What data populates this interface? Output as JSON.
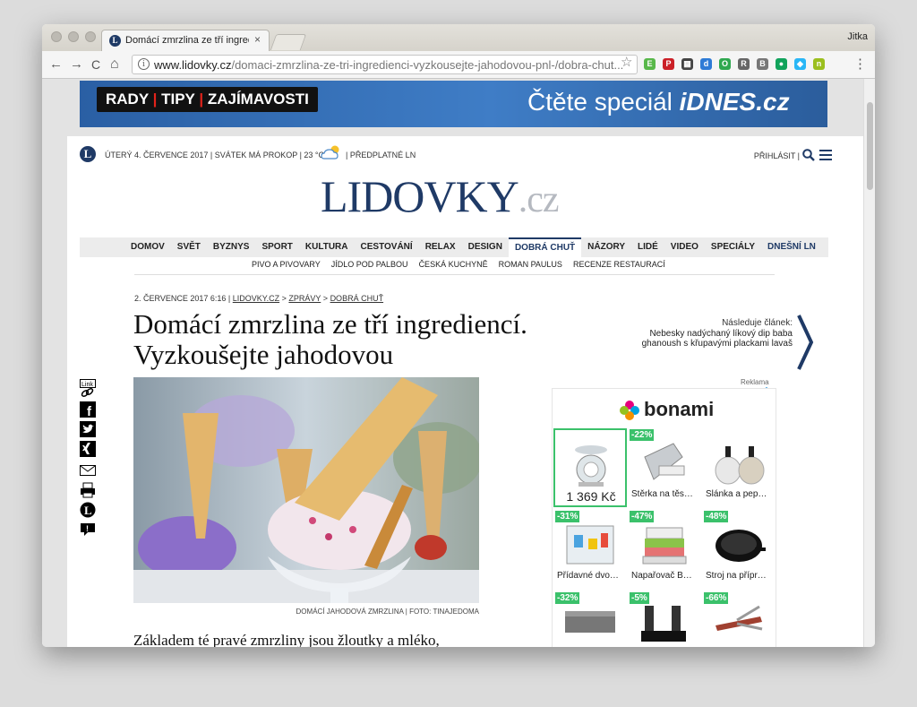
{
  "browser": {
    "user_name": "Jitka",
    "tab": {
      "title": "Domácí zmrzlina ze tří ingredi",
      "close": "×"
    },
    "nav": {
      "back": "←",
      "forward": "→",
      "reload": "C",
      "home": "⌂"
    },
    "url_host": "www.lidovky.cz",
    "url_path": "/domaci-zmrzlina-ze-tri-ingredienci-vyzkousejte-jahodovou-pnl-/dobra-chut....",
    "star": "☆",
    "menu": "⋮",
    "extensions": [
      {
        "name": "evernote-icon",
        "color": "#58b84a",
        "glyph": "E"
      },
      {
        "name": "pinterest-icon",
        "color": "#cb2027",
        "glyph": "P"
      },
      {
        "name": "film-icon",
        "color": "#444444",
        "glyph": "▦"
      },
      {
        "name": "d-icon",
        "color": "#2e7bd6",
        "glyph": "d"
      },
      {
        "name": "o-icon",
        "color": "#2fa84f",
        "glyph": "O"
      },
      {
        "name": "reader-icon",
        "color": "#666666",
        "glyph": "R"
      },
      {
        "name": "book-icon",
        "color": "#777777",
        "glyph": "B"
      },
      {
        "name": "leaf-icon",
        "color": "#11a35b",
        "glyph": "●"
      },
      {
        "name": "diamond-icon",
        "color": "#29b6f6",
        "glyph": "◆"
      },
      {
        "name": "n-icon",
        "color": "#9bbf1e",
        "glyph": "n"
      }
    ]
  },
  "banner": {
    "parts": [
      "RADY",
      "TIPY",
      "ZAJÍMAVOSTI"
    ],
    "separator": "|",
    "text": "Čtěte speciál",
    "brand": "iDNES.cz"
  },
  "header": {
    "logo_letter": "L",
    "date_info": "ÚTERÝ 4. ČERVENCE 2017 | SVÁTEK MÁ PROKOP | 23 °C",
    "subscription": "| PŘEDPLATNÉ LN",
    "login": "PŘIHLÁSIT |",
    "logo_main": "LIDOVKY",
    "logo_cz": ".cz"
  },
  "nav": {
    "items": [
      "DOMOV",
      "SVĚT",
      "BYZNYS",
      "SPORT",
      "KULTURA",
      "CESTOVÁNÍ",
      "RELAX",
      "DESIGN",
      "DOBRÁ CHUŤ",
      "NÁZORY",
      "LIDÉ",
      "VIDEO",
      "SPECIÁLY",
      "DNEŠNÍ LN"
    ],
    "sub_items": [
      "PIVO A PIVOVARY",
      "JÍDLO POD PALBOU",
      "ČESKÁ KUCHYNĚ",
      "ROMAN PAULUS",
      "RECENZE RESTAURACÍ"
    ]
  },
  "article": {
    "date": "2. ČERVENCE 2017 6:16 |",
    "crumb_site": "LIDOVKY.CZ",
    "crumb_sep": ">",
    "crumb_section": "ZPRÁVY",
    "crumb_category": "DOBRÁ CHUŤ",
    "title_line1": "Domácí zmrzlina ze tří ingrediencí.",
    "title_line2": "Vyzkoušejte jahodovou",
    "photo_caption": "DOMÁCÍ JAHODOVÁ ZMRZLINA | FOTO: TINAJEDOMA",
    "lead": "Základem té pravé zmrzliny jsou žloutky a mléko,"
  },
  "next": {
    "label": "Následuje článek:",
    "title": "Nebesky nadýchaný líkový dip baba ghanoush s křupavými plackami lavaš"
  },
  "share": {
    "link_label": "Link"
  },
  "ad": {
    "reklama": "Reklama",
    "brand": "bonami",
    "products": [
      {
        "label": "1 369 Kč",
        "badge": "",
        "selected": true,
        "icon": "kitchen-scale-image"
      },
      {
        "label": "Stěrka na těs…",
        "badge": "-22%",
        "selected": false,
        "icon": "scraper-image"
      },
      {
        "label": "Slánka a pep…",
        "badge": "",
        "selected": false,
        "icon": "salt-pepper-image"
      },
      {
        "label": "Přídavné dvo…",
        "badge": "-31%",
        "selected": false,
        "icon": "fridge-image"
      },
      {
        "label": "Napařovač B…",
        "badge": "-47%",
        "selected": false,
        "icon": "steamer-image"
      },
      {
        "label": "Stroj na přípr…",
        "badge": "-48%",
        "selected": false,
        "icon": "crepe-maker-image"
      },
      {
        "label": "",
        "badge": "-32%",
        "selected": false,
        "icon": "box-image"
      },
      {
        "label": "",
        "badge": "-5%",
        "selected": false,
        "icon": "oil-vinegar-image"
      },
      {
        "label": "",
        "badge": "-66%",
        "selected": false,
        "icon": "multitool-image"
      }
    ]
  }
}
